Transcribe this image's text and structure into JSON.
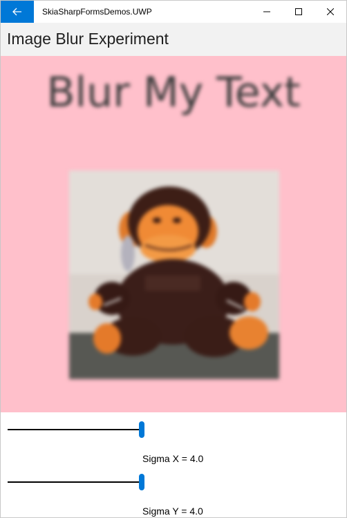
{
  "window": {
    "app_title": "SkiaSharpFormsDemos.UWP",
    "accent_color": "#0078d7",
    "back_icon": "arrow-left-icon",
    "minimize_icon": "minimize-icon",
    "maximize_icon": "maximize-icon",
    "close_icon": "close-icon"
  },
  "page": {
    "title": "Image Blur Experiment"
  },
  "canvas": {
    "background_color": "#ffc0cb",
    "text": "Blur My Text",
    "image_subject": "blurred stuffed monkey toy photo"
  },
  "controls": {
    "sigma_x": {
      "label": "Sigma X = 4.0",
      "value": 4.0,
      "fraction": 0.97
    },
    "sigma_y": {
      "label": "Sigma Y = 4.0",
      "value": 4.0,
      "fraction": 0.97
    }
  }
}
